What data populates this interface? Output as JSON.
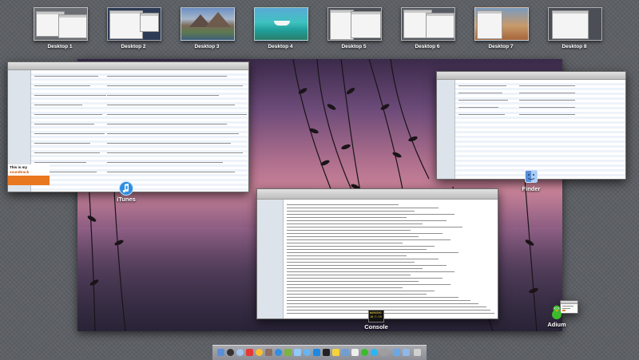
{
  "spaces": [
    {
      "label": "Desktop 1"
    },
    {
      "label": "Desktop 2"
    },
    {
      "label": "Desktop 3"
    },
    {
      "label": "Desktop 4"
    },
    {
      "label": "Desktop 5"
    },
    {
      "label": "Desktop 6"
    },
    {
      "label": "Desktop 7"
    },
    {
      "label": "Desktop 8"
    }
  ],
  "apps": {
    "itunes": {
      "label": "iTunes",
      "promo_line1": "This is my",
      "promo_line2": "soundtrack"
    },
    "finder": {
      "label": "Finder"
    },
    "console": {
      "label": "Console",
      "icon_text": "WARNING\n10:7:19"
    },
    "adium": {
      "label": "Adium"
    }
  },
  "colors": {
    "itunes_accent": "#2f8fe0",
    "finder_accent": "#5a8fd8",
    "adium_green": "#3dbb2c",
    "promo_orange": "#e8771f"
  },
  "dock": {
    "icons": [
      "finder-icon",
      "dashboard-icon",
      "safari-icon",
      "ical-icon",
      "chrome-icon",
      "addressbook-icon",
      "itunes-icon",
      "photos-icon",
      "mail-icon",
      "messages-icon",
      "app-store-icon",
      "terminal-icon",
      "console-icon",
      "preview-icon",
      "textedit-icon",
      "adium-icon",
      "skype-icon",
      "preferences-icon",
      "downloads-icon",
      "folder-icon",
      "trash-icon"
    ]
  }
}
